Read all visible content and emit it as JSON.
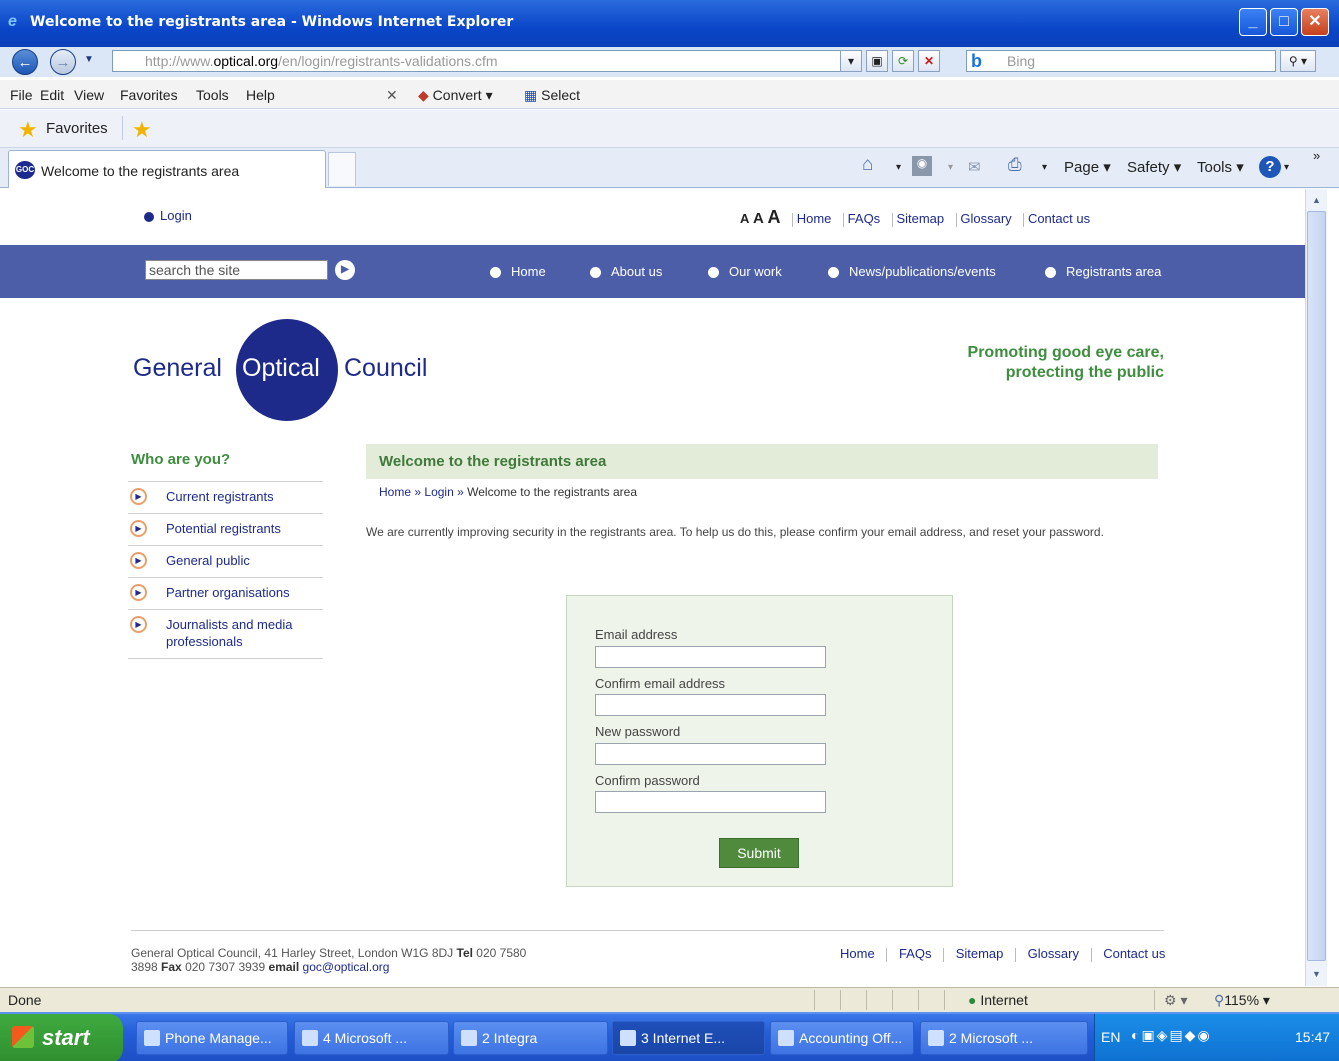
{
  "window": {
    "title": "Welcome to the registrants area - Windows Internet Explorer"
  },
  "address": {
    "prefix": "http://www.",
    "domain": "optical.org",
    "path": "/en/login/registrants-validations.cfm",
    "search_placeholder": "Bing"
  },
  "menu": {
    "file": "File",
    "edit": "Edit",
    "view": "View",
    "favorites": "Favorites",
    "tools": "Tools",
    "help": "Help",
    "convert": "Convert",
    "select": "Select"
  },
  "favbar": {
    "favorites": "Favorites"
  },
  "tab": {
    "title": "Welcome to the registrants area"
  },
  "commandbar": {
    "page": "Page",
    "safety": "Safety",
    "tools": "Tools"
  },
  "site": {
    "login": "Login",
    "text_sizes": [
      "A",
      "A",
      "A"
    ],
    "top_links": [
      "Home",
      "FAQs",
      "Sitemap",
      "Glossary",
      "Contact us"
    ],
    "search_placeholder": "search the site",
    "nav": [
      "Home",
      "About us",
      "Our work",
      "News/publications/events",
      "Registrants area"
    ],
    "logo": {
      "word1": "General",
      "word2": "Optical",
      "word3": "Council"
    },
    "tagline": [
      "Promoting good eye care,",
      "protecting the public"
    ],
    "who_heading": "Who are you?",
    "who_items": [
      "Current registrants",
      "Potential registrants",
      "General public",
      "Partner organisations",
      "Journalists and media professionals"
    ],
    "page_heading": "Welcome to the registrants area",
    "breadcrumb": {
      "home": "Home",
      "login": "Login",
      "current": "Welcome to the registrants area",
      "sep": "»"
    },
    "intro": "We are currently improving security in the registrants area. To help us do this, please confirm your email address, and reset your password.",
    "form": {
      "email_label": "Email address",
      "confirm_email_label": "Confirm email address",
      "password_label": "New password",
      "confirm_password_label": "Confirm password",
      "submit_label": "Submit"
    },
    "footer": {
      "address": "General Optical Council, 41 Harley Street, London W1G 8DJ",
      "tel_label": "Tel",
      "tel": "020 7580 3898",
      "fax_label": "Fax",
      "fax": "020 7307 3939",
      "email_label": "email",
      "email": "goc@optical.org",
      "links": [
        "Home",
        "FAQs",
        "Sitemap",
        "Glossary",
        "Contact us"
      ]
    }
  },
  "status": {
    "text": "Done",
    "zone": "Internet",
    "zoom": "115%"
  },
  "taskbar": {
    "start": "start",
    "tasks": [
      "Phone Manage...",
      "4 Microsoft ...",
      "2 Integra",
      "3 Internet E...",
      "Accounting Off...",
      "2 Microsoft ..."
    ],
    "lang": "EN",
    "clock": "15:47"
  }
}
